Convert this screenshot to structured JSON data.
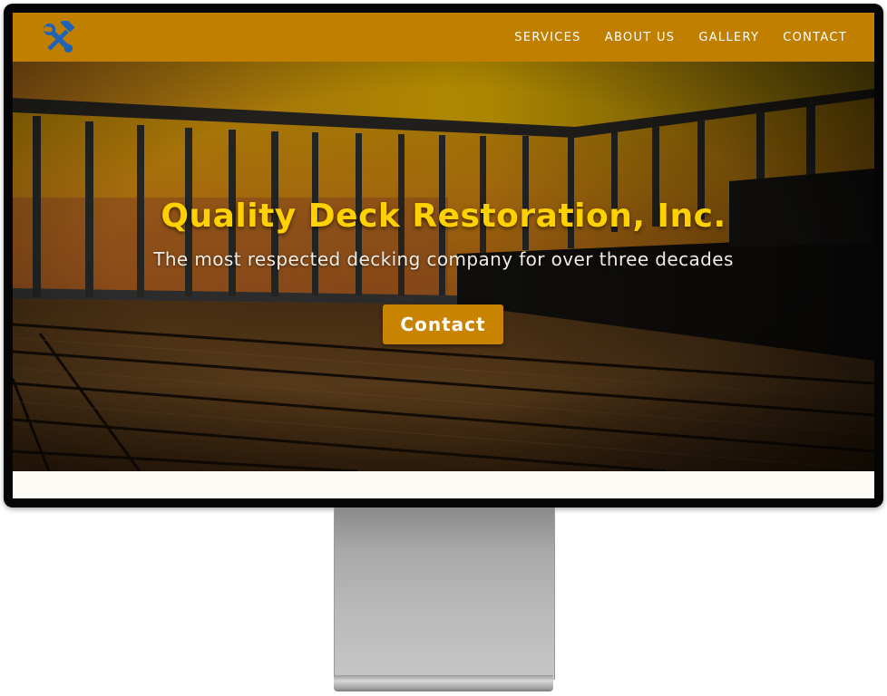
{
  "nav": {
    "logo_icon": "hammer-wrench-icon",
    "links": [
      "SERVICES",
      "ABOUT US",
      "GALLERY",
      "CONTACT"
    ]
  },
  "hero": {
    "title": "Quality Deck Restoration, Inc.",
    "subtitle": "The most respected decking company for over three decades",
    "cta_label": "Contact"
  },
  "colors": {
    "brand": "#c17f00",
    "title": "#ffd100",
    "button": "#c88400"
  }
}
